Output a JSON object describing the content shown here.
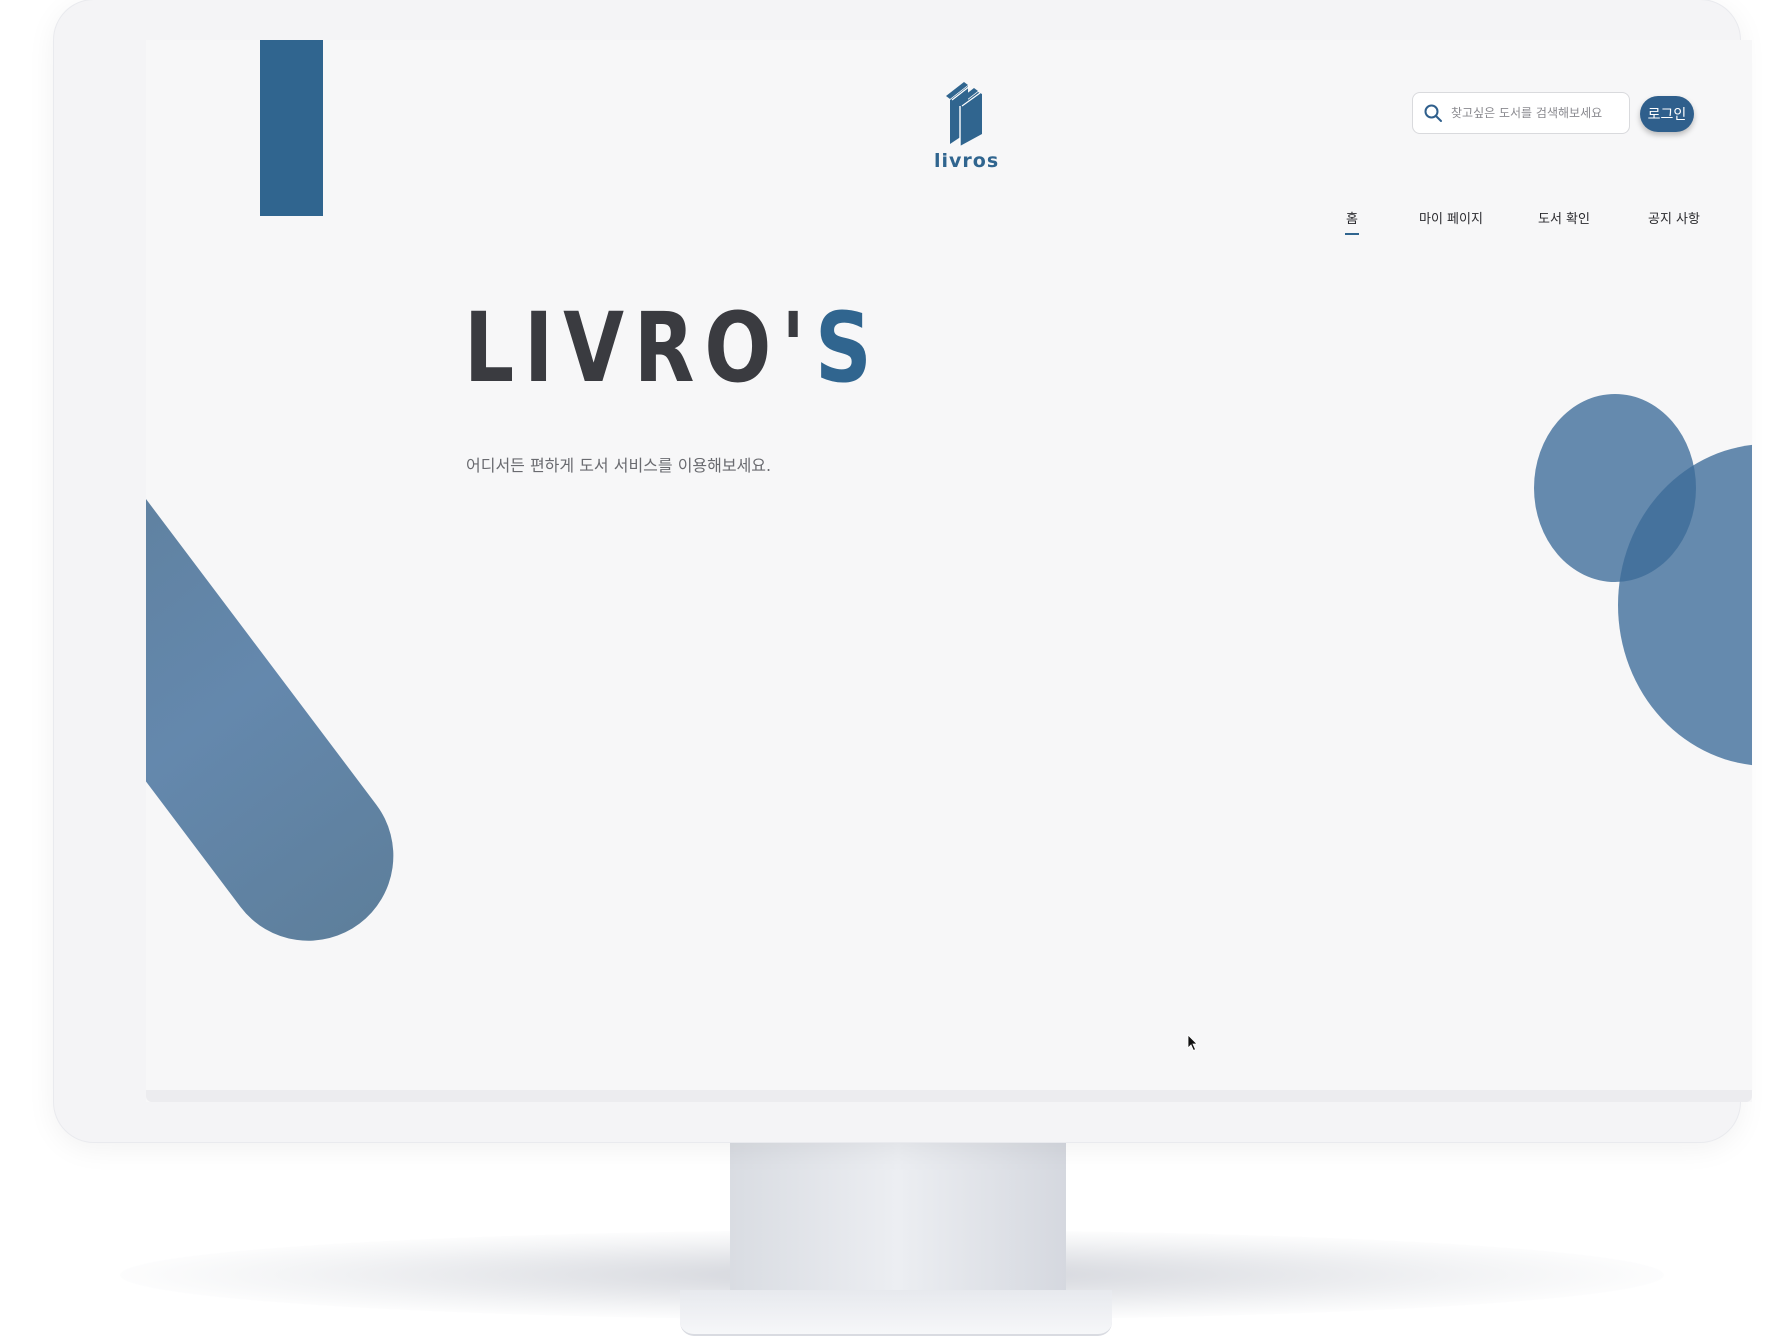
{
  "header": {
    "logo_text": "livros",
    "search": {
      "placeholder": "찾고싶은 도서를 검색해보세요"
    },
    "login_label": "로그인"
  },
  "nav": {
    "items": [
      {
        "label": "홈",
        "active": true
      },
      {
        "label": "마이 페이지",
        "active": false
      },
      {
        "label": "도서 확인",
        "active": false
      },
      {
        "label": "공지 사항",
        "active": false
      }
    ]
  },
  "hero": {
    "title_main": "LIVRO'",
    "title_accent": "S",
    "subtitle": "어디서든 편하게 도서 서비스를 이용해보세요."
  },
  "colors": {
    "brand": "#30658f",
    "title": "#3a3b40",
    "background": "#f7f7f8"
  },
  "icons": {
    "logo": "books-icon",
    "search": "search-icon",
    "cursor": "mouse-pointer-icon"
  }
}
